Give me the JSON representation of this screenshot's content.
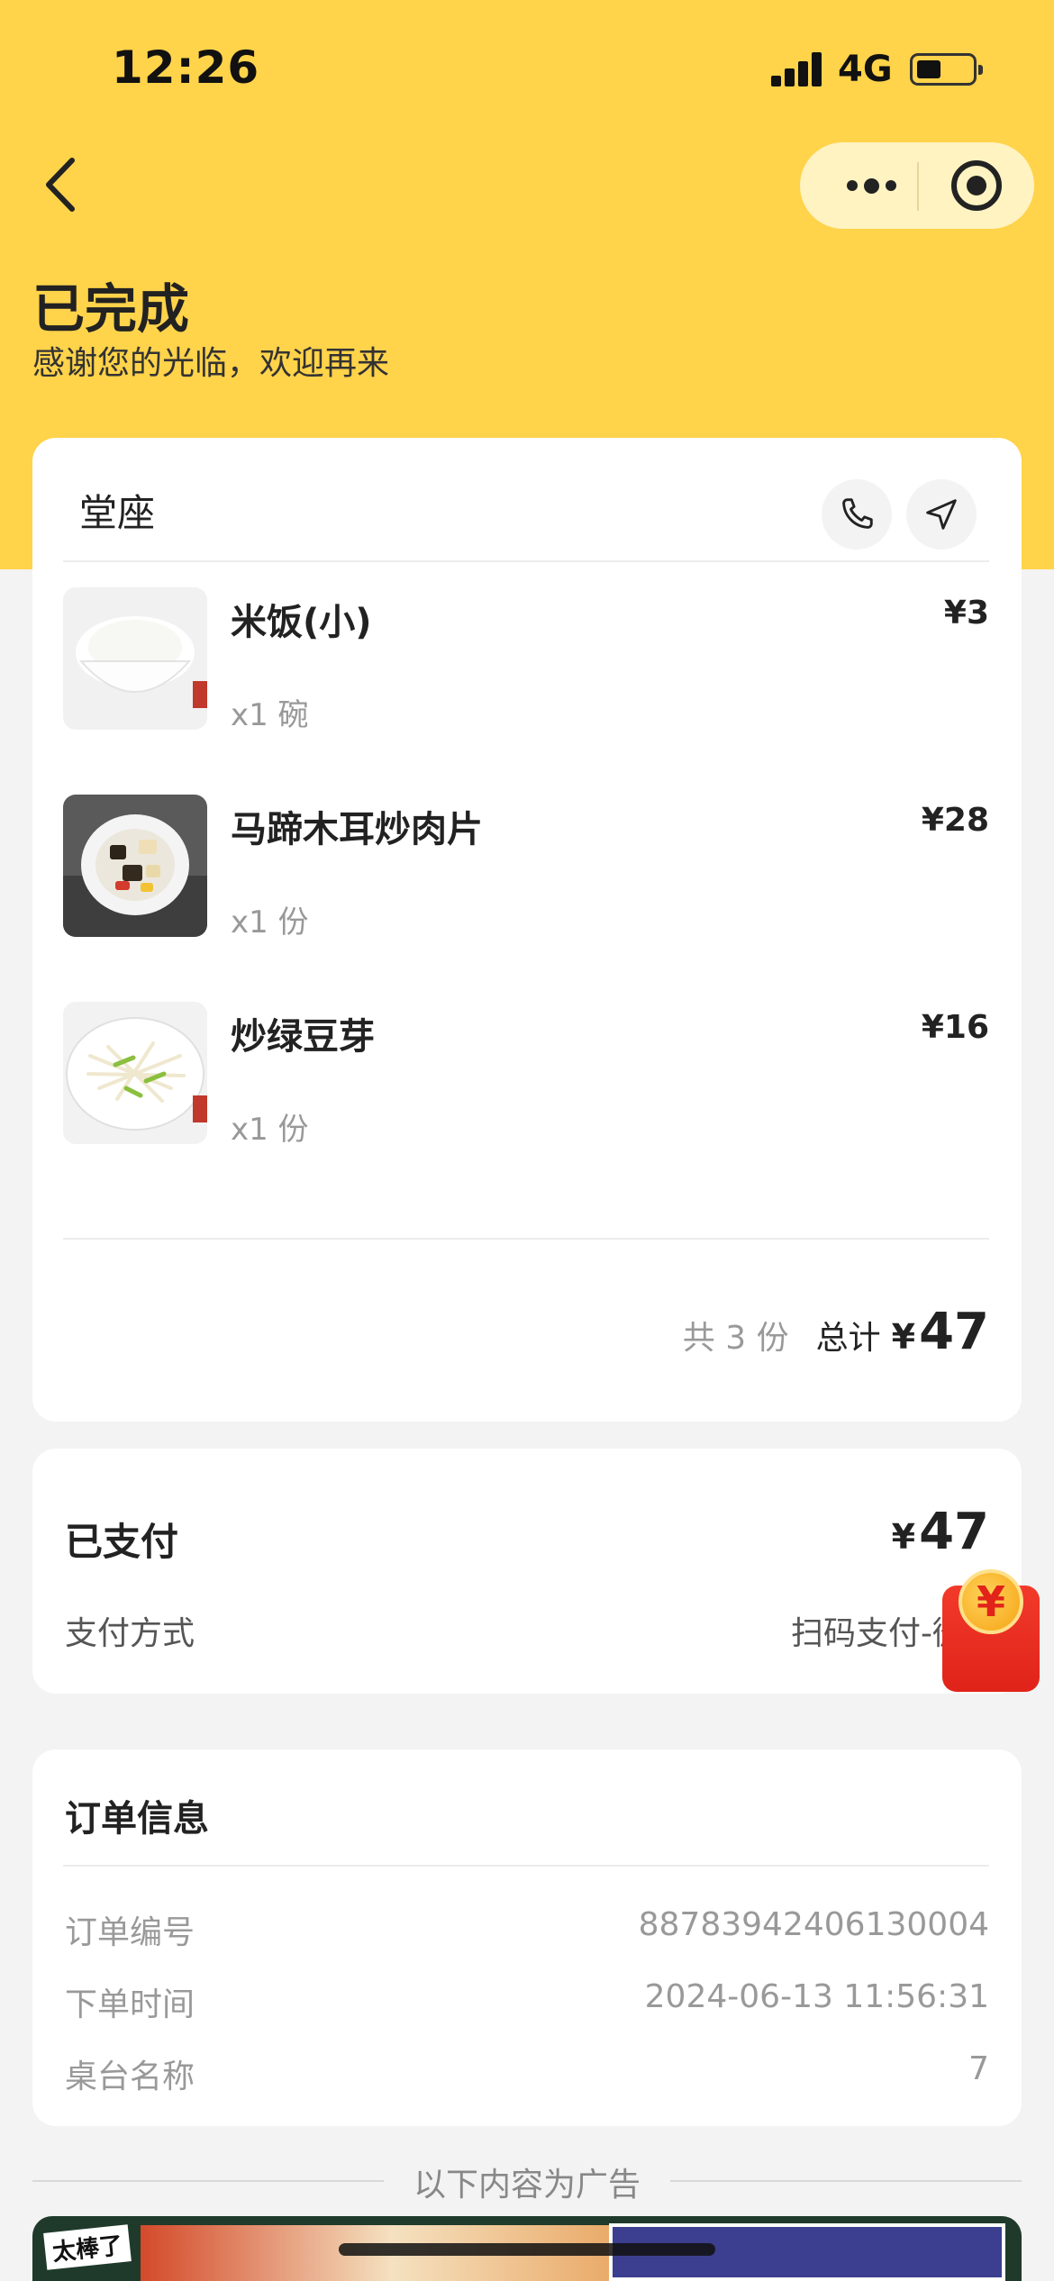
{
  "status_bar": {
    "time": "12:26",
    "network": "4G"
  },
  "header": {
    "title": "已完成",
    "subtitle": "感谢您的光临，欢迎再来"
  },
  "order": {
    "type": "堂座",
    "items": [
      {
        "name": "米饭(小)",
        "qty": "x1 碗",
        "price": "¥3"
      },
      {
        "name": "马蹄木耳炒肉片",
        "qty": "x1 份",
        "price": "¥28"
      },
      {
        "name": "炒绿豆芽",
        "qty": "x1 份",
        "price": "¥16"
      }
    ],
    "count_text": "共 3 份",
    "total_label": "总计",
    "currency": "¥",
    "total": "47"
  },
  "payment": {
    "paid_label": "已支付",
    "currency": "¥",
    "amount": "47",
    "method_label": "支付方式",
    "method_value": "扫码支付-微"
  },
  "order_info": {
    "title": "订单信息",
    "rows": [
      {
        "key": "订单编号",
        "value": "88783942406130004"
      },
      {
        "key": "下单时间",
        "value": "2024-06-13 11:56:31"
      },
      {
        "key": "桌台名称",
        "value": "7"
      }
    ]
  },
  "ad": {
    "divider_text": "以下内容为广告",
    "tag": "太棒了"
  },
  "icons": {
    "back": "chevron-left-icon",
    "more": "more-dots-icon",
    "close": "target-circle-icon",
    "phone": "phone-icon",
    "navigate": "navigation-arrow-icon",
    "redpacket": "red-envelope-icon"
  },
  "colors": {
    "header": "#ffd34a",
    "background": "#f3f3f3",
    "card": "#ffffff"
  }
}
